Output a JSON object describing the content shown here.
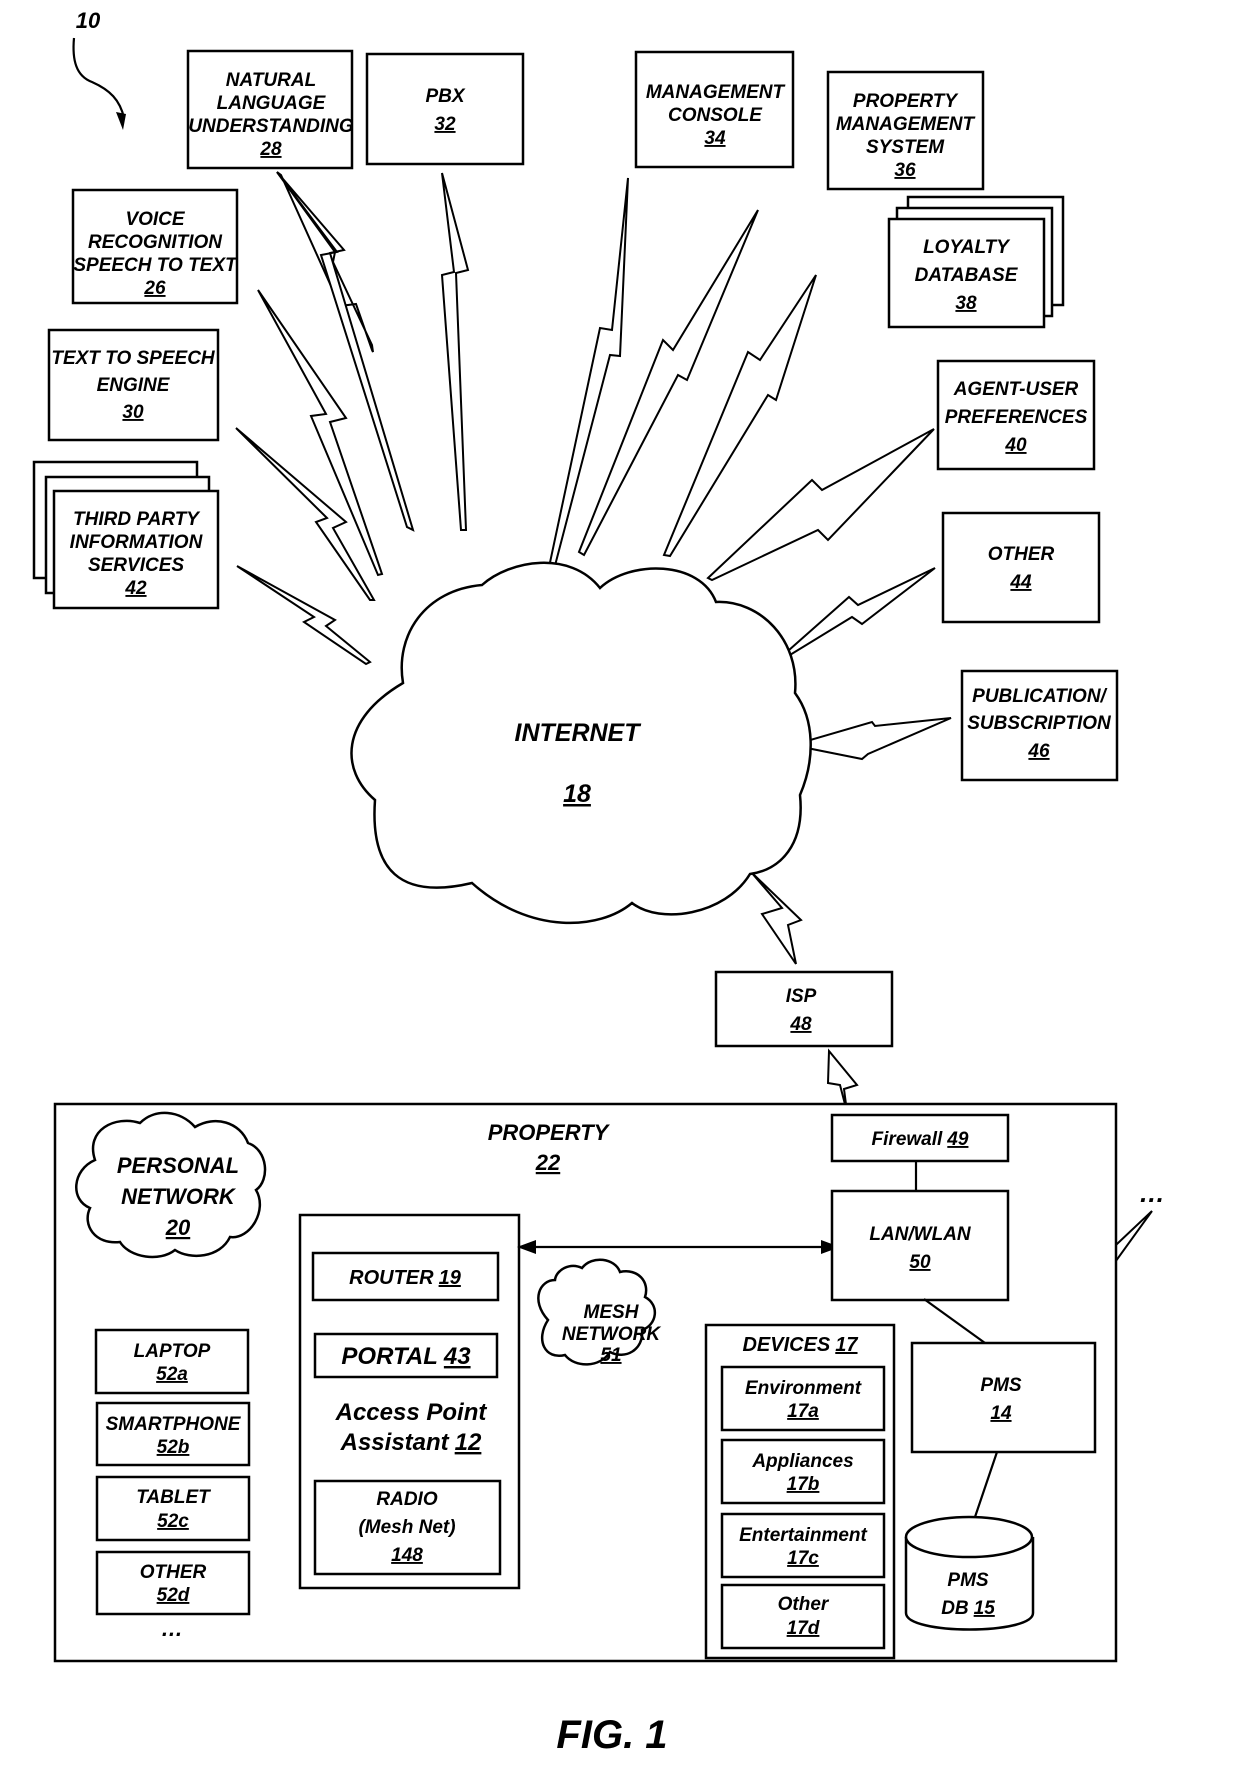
{
  "figure": {
    "ref": "10",
    "caption": "FIG. 1"
  },
  "internet": {
    "label": "INTERNET",
    "ref": "18"
  },
  "services": [
    {
      "id": "nlu",
      "lines": [
        "NATURAL",
        "LANGUAGE",
        "UNDERSTANDING"
      ],
      "ref": "28"
    },
    {
      "id": "pbx",
      "lines": [
        "PBX"
      ],
      "ref": "32"
    },
    {
      "id": "mgmt-console",
      "lines": [
        "MANAGEMENT",
        "CONSOLE"
      ],
      "ref": "34"
    },
    {
      "id": "pms-system",
      "lines": [
        "PROPERTY",
        "MANAGEMENT",
        "SYSTEM"
      ],
      "ref": "36"
    },
    {
      "id": "voice",
      "lines": [
        "VOICE",
        "RECOGNITION",
        "SPEECH TO TEXT"
      ],
      "ref": "26"
    },
    {
      "id": "loyalty",
      "lines": [
        "LOYALTY",
        "DATABASE"
      ],
      "ref": "38"
    },
    {
      "id": "tts",
      "lines": [
        "TEXT TO SPEECH",
        "ENGINE"
      ],
      "ref": "30"
    },
    {
      "id": "agent-prefs",
      "lines": [
        "AGENT-USER",
        "PREFERENCES"
      ],
      "ref": "40"
    },
    {
      "id": "third-party",
      "lines": [
        "THIRD PARTY",
        "INFORMATION",
        "SERVICES"
      ],
      "ref": "42"
    },
    {
      "id": "other",
      "lines": [
        "OTHER"
      ],
      "ref": "44"
    },
    {
      "id": "pubsub",
      "lines": [
        "PUBLICATION/",
        "SUBSCRIPTION"
      ],
      "ref": "46"
    }
  ],
  "isp": {
    "label": "ISP",
    "ref": "48"
  },
  "property": {
    "label": "PROPERTY",
    "ref": "22",
    "personal_network": {
      "lines": [
        "PERSONAL",
        "NETWORK"
      ],
      "ref": "20"
    },
    "personal_devices": [
      {
        "label": "LAPTOP",
        "ref": "52a"
      },
      {
        "label": "SMARTPHONE",
        "ref": "52b"
      },
      {
        "label": "TABLET",
        "ref": "52c"
      },
      {
        "label": "OTHER",
        "ref": "52d"
      }
    ],
    "ellipsis": "…",
    "access_point": {
      "router": {
        "label": "ROUTER",
        "ref": "19"
      },
      "portal": {
        "label": "PORTAL",
        "ref": "43"
      },
      "title_line1": "Access Point",
      "title_line2": "Assistant",
      "ref": "12",
      "radio": {
        "lines": [
          "RADIO",
          "(Mesh Net)"
        ],
        "ref": "148"
      }
    },
    "mesh_network": {
      "lines": [
        "MESH",
        "NETWORK"
      ],
      "ref": "51"
    },
    "devices": {
      "label": "DEVICES",
      "ref": "17",
      "items": [
        {
          "label": "Environment",
          "ref": "17a"
        },
        {
          "label": "Appliances",
          "ref": "17b"
        },
        {
          "label": "Entertainment",
          "ref": "17c"
        },
        {
          "label": "Other",
          "ref": "17d"
        }
      ]
    },
    "firewall": {
      "label": "Firewall",
      "ref": "49"
    },
    "lan": {
      "label": "LAN/WLAN",
      "ref": "50"
    },
    "pms": {
      "label": "PMS",
      "ref": "14"
    },
    "pms_db": {
      "line1": "PMS",
      "line2": "DB",
      "ref": "15"
    },
    "external_ellipsis": "…"
  }
}
